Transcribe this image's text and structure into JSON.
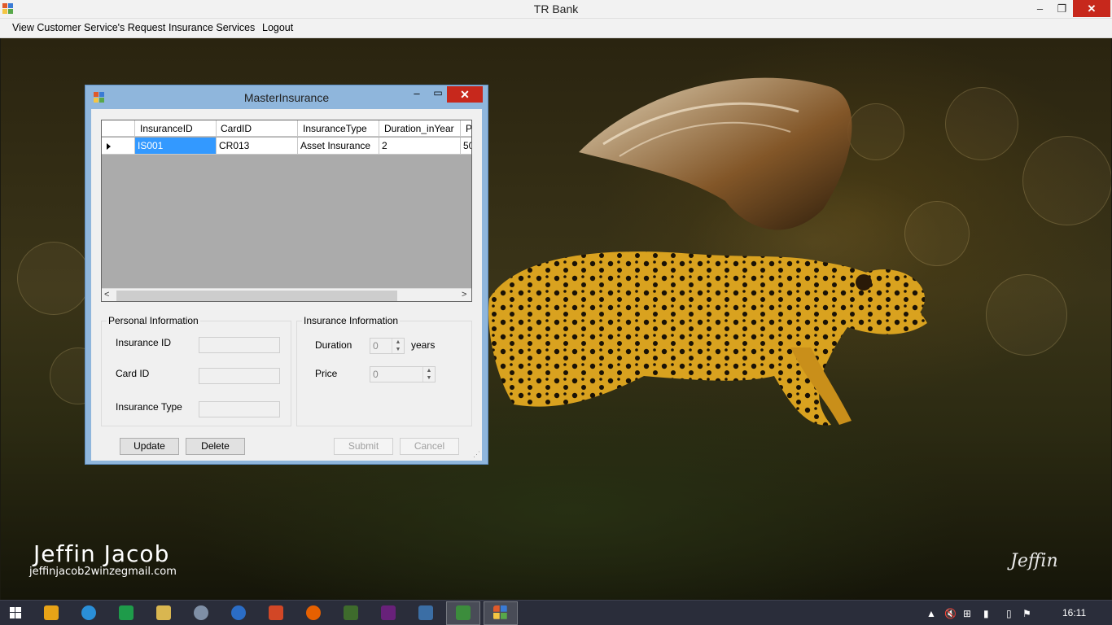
{
  "window": {
    "title": "TR Bank",
    "min": "–",
    "max": "❐",
    "close": "✕"
  },
  "menu": {
    "items": [
      "View Customer Service's Request",
      "Insurance Services",
      "Logout"
    ]
  },
  "wallpaper": {
    "signature_name": "Jeffin Jacob",
    "signature_email": "jeffinjacob2winzegmail.com",
    "logo_text": "Jeffin"
  },
  "dialog": {
    "title": "MasterInsurance",
    "min": "–",
    "max": "▭",
    "close": "✕",
    "grid": {
      "columns": [
        "InsuranceID",
        "CardID",
        "InsuranceType",
        "Duration_inYear",
        "P"
      ],
      "rows": [
        [
          "IS001",
          "CR013",
          "Asset Insurance",
          "2",
          "50"
        ]
      ],
      "scroll_left": "<",
      "scroll_right": ">"
    },
    "personal": {
      "title": "Personal Information",
      "insurance_id_label": "Insurance ID",
      "card_id_label": "Card ID",
      "insurance_type_label": "Insurance Type"
    },
    "insurance": {
      "title": "Insurance Information",
      "duration_label": "Duration",
      "duration_value": "0",
      "duration_unit": "years",
      "price_label": "Price",
      "price_value": "0"
    },
    "buttons": {
      "update": "Update",
      "delete": "Delete",
      "submit": "Submit",
      "cancel": "Cancel"
    }
  },
  "taskbar": {
    "clock": "16:11"
  }
}
